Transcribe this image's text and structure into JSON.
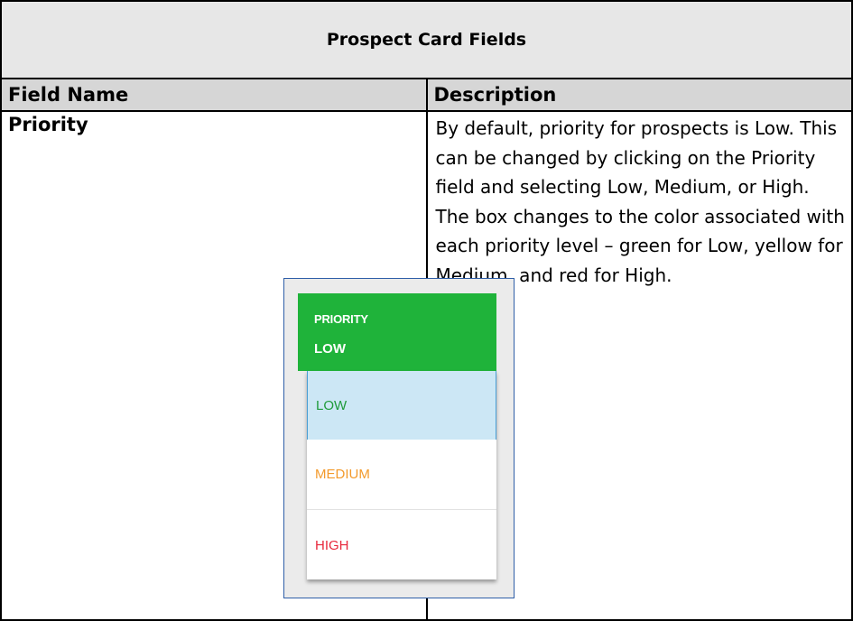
{
  "table": {
    "title": "Prospect Card Fields",
    "headers": [
      "Field Name",
      "Description"
    ],
    "rows": [
      {
        "field": "Priority",
        "description": "By default, priority for prospects is Low. This can be changed by clicking on the Priority field and selecting Low, Medium, or High. The box changes to the color associated with each priority level – green for Low, yellow for Medium, and red for High."
      }
    ]
  },
  "priority_widget": {
    "label": "PRIORITY",
    "value": "LOW",
    "options": [
      "LOW",
      "MEDIUM",
      "HIGH"
    ],
    "colors": {
      "low": "#1fb33a",
      "medium": "#f39a2b",
      "high": "#e8283c",
      "hover": "#cce7f5"
    }
  }
}
